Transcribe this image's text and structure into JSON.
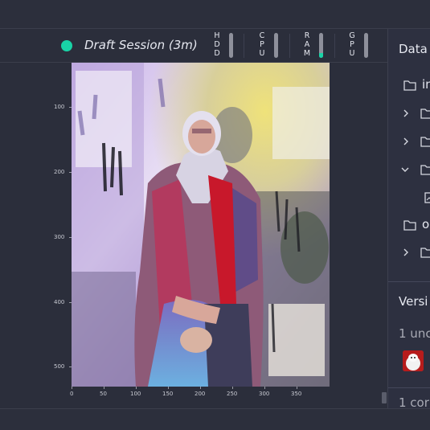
{
  "session": {
    "title": "Draft Session (3m)",
    "status_color": "#19d3a6"
  },
  "resources": [
    {
      "label": "HDD",
      "level": 0.0
    },
    {
      "label": "CPU",
      "level": 0.0
    },
    {
      "label": "RAM",
      "level": 0.2
    },
    {
      "label": "GPU",
      "level": 0.0
    }
  ],
  "plot": {
    "y_ticks": [
      "100",
      "200",
      "300",
      "400",
      "500"
    ],
    "x_ticks": [
      "0",
      "50",
      "100",
      "150",
      "200",
      "250",
      "300",
      "350"
    ]
  },
  "data_panel": {
    "heading": "Data",
    "items": [
      {
        "label": "in"
      },
      {
        "label": ""
      },
      {
        "label": ""
      },
      {
        "label": ""
      },
      {
        "label": ""
      },
      {
        "label": "o"
      },
      {
        "label": ""
      }
    ]
  },
  "versions_panel": {
    "heading": "Versi",
    "uncommitted": "1 unc",
    "committed": "1 cor"
  },
  "colors": {
    "accent": "#19d3a6",
    "background": "#2b2e3b",
    "panel": "#2d3040"
  }
}
